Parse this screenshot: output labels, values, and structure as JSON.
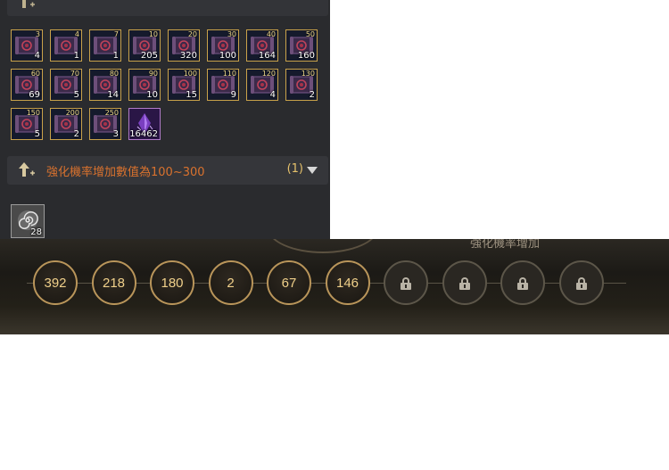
{
  "panel": {
    "header_main": {
      "title": "強化機率增加數值為100~300",
      "count": "(1)"
    },
    "items": [
      {
        "level": "3",
        "qty": "4",
        "kind": "scroll"
      },
      {
        "level": "4",
        "qty": "1",
        "kind": "scroll"
      },
      {
        "level": "7",
        "qty": "1",
        "kind": "scroll"
      },
      {
        "level": "10",
        "qty": "205",
        "kind": "scroll"
      },
      {
        "level": "20",
        "qty": "320",
        "kind": "scroll"
      },
      {
        "level": "30",
        "qty": "100",
        "kind": "scroll"
      },
      {
        "level": "40",
        "qty": "164",
        "kind": "scroll"
      },
      {
        "level": "50",
        "qty": "160",
        "kind": "scroll"
      },
      {
        "level": "60",
        "qty": "69",
        "kind": "scroll"
      },
      {
        "level": "70",
        "qty": "5",
        "kind": "scroll"
      },
      {
        "level": "80",
        "qty": "14",
        "kind": "scroll"
      },
      {
        "level": "90",
        "qty": "10",
        "kind": "scroll"
      },
      {
        "level": "100",
        "qty": "15",
        "kind": "scroll"
      },
      {
        "level": "110",
        "qty": "9",
        "kind": "scroll"
      },
      {
        "level": "120",
        "qty": "4",
        "kind": "scroll"
      },
      {
        "level": "130",
        "qty": "2",
        "kind": "scroll"
      },
      {
        "level": "150",
        "qty": "5",
        "kind": "scroll"
      },
      {
        "level": "200",
        "qty": "2",
        "kind": "scroll"
      },
      {
        "level": "250",
        "qty": "3",
        "kind": "scroll"
      },
      {
        "level": "",
        "qty": "16462",
        "kind": "crystal"
      }
    ],
    "extra_item": {
      "qty": "28",
      "kind": "swirl"
    }
  },
  "track": {
    "label": "強化機率增加",
    "nodes": [
      {
        "value": "392",
        "locked": false
      },
      {
        "value": "218",
        "locked": false
      },
      {
        "value": "180",
        "locked": false
      },
      {
        "value": "2",
        "locked": false
      },
      {
        "value": "67",
        "locked": false
      },
      {
        "value": "146",
        "locked": false
      },
      {
        "value": "",
        "locked": true
      },
      {
        "value": "",
        "locked": true
      },
      {
        "value": "",
        "locked": true
      },
      {
        "value": "",
        "locked": true
      }
    ]
  },
  "colors": {
    "accent_text": "#d9722e",
    "gold": "#c9a24a",
    "node_number": "#f0d08a"
  },
  "icons": {
    "section_icon": "arrow-up-plus-icon",
    "expand_icon": "triangle-down-icon",
    "lock_icon": "lock-icon"
  }
}
